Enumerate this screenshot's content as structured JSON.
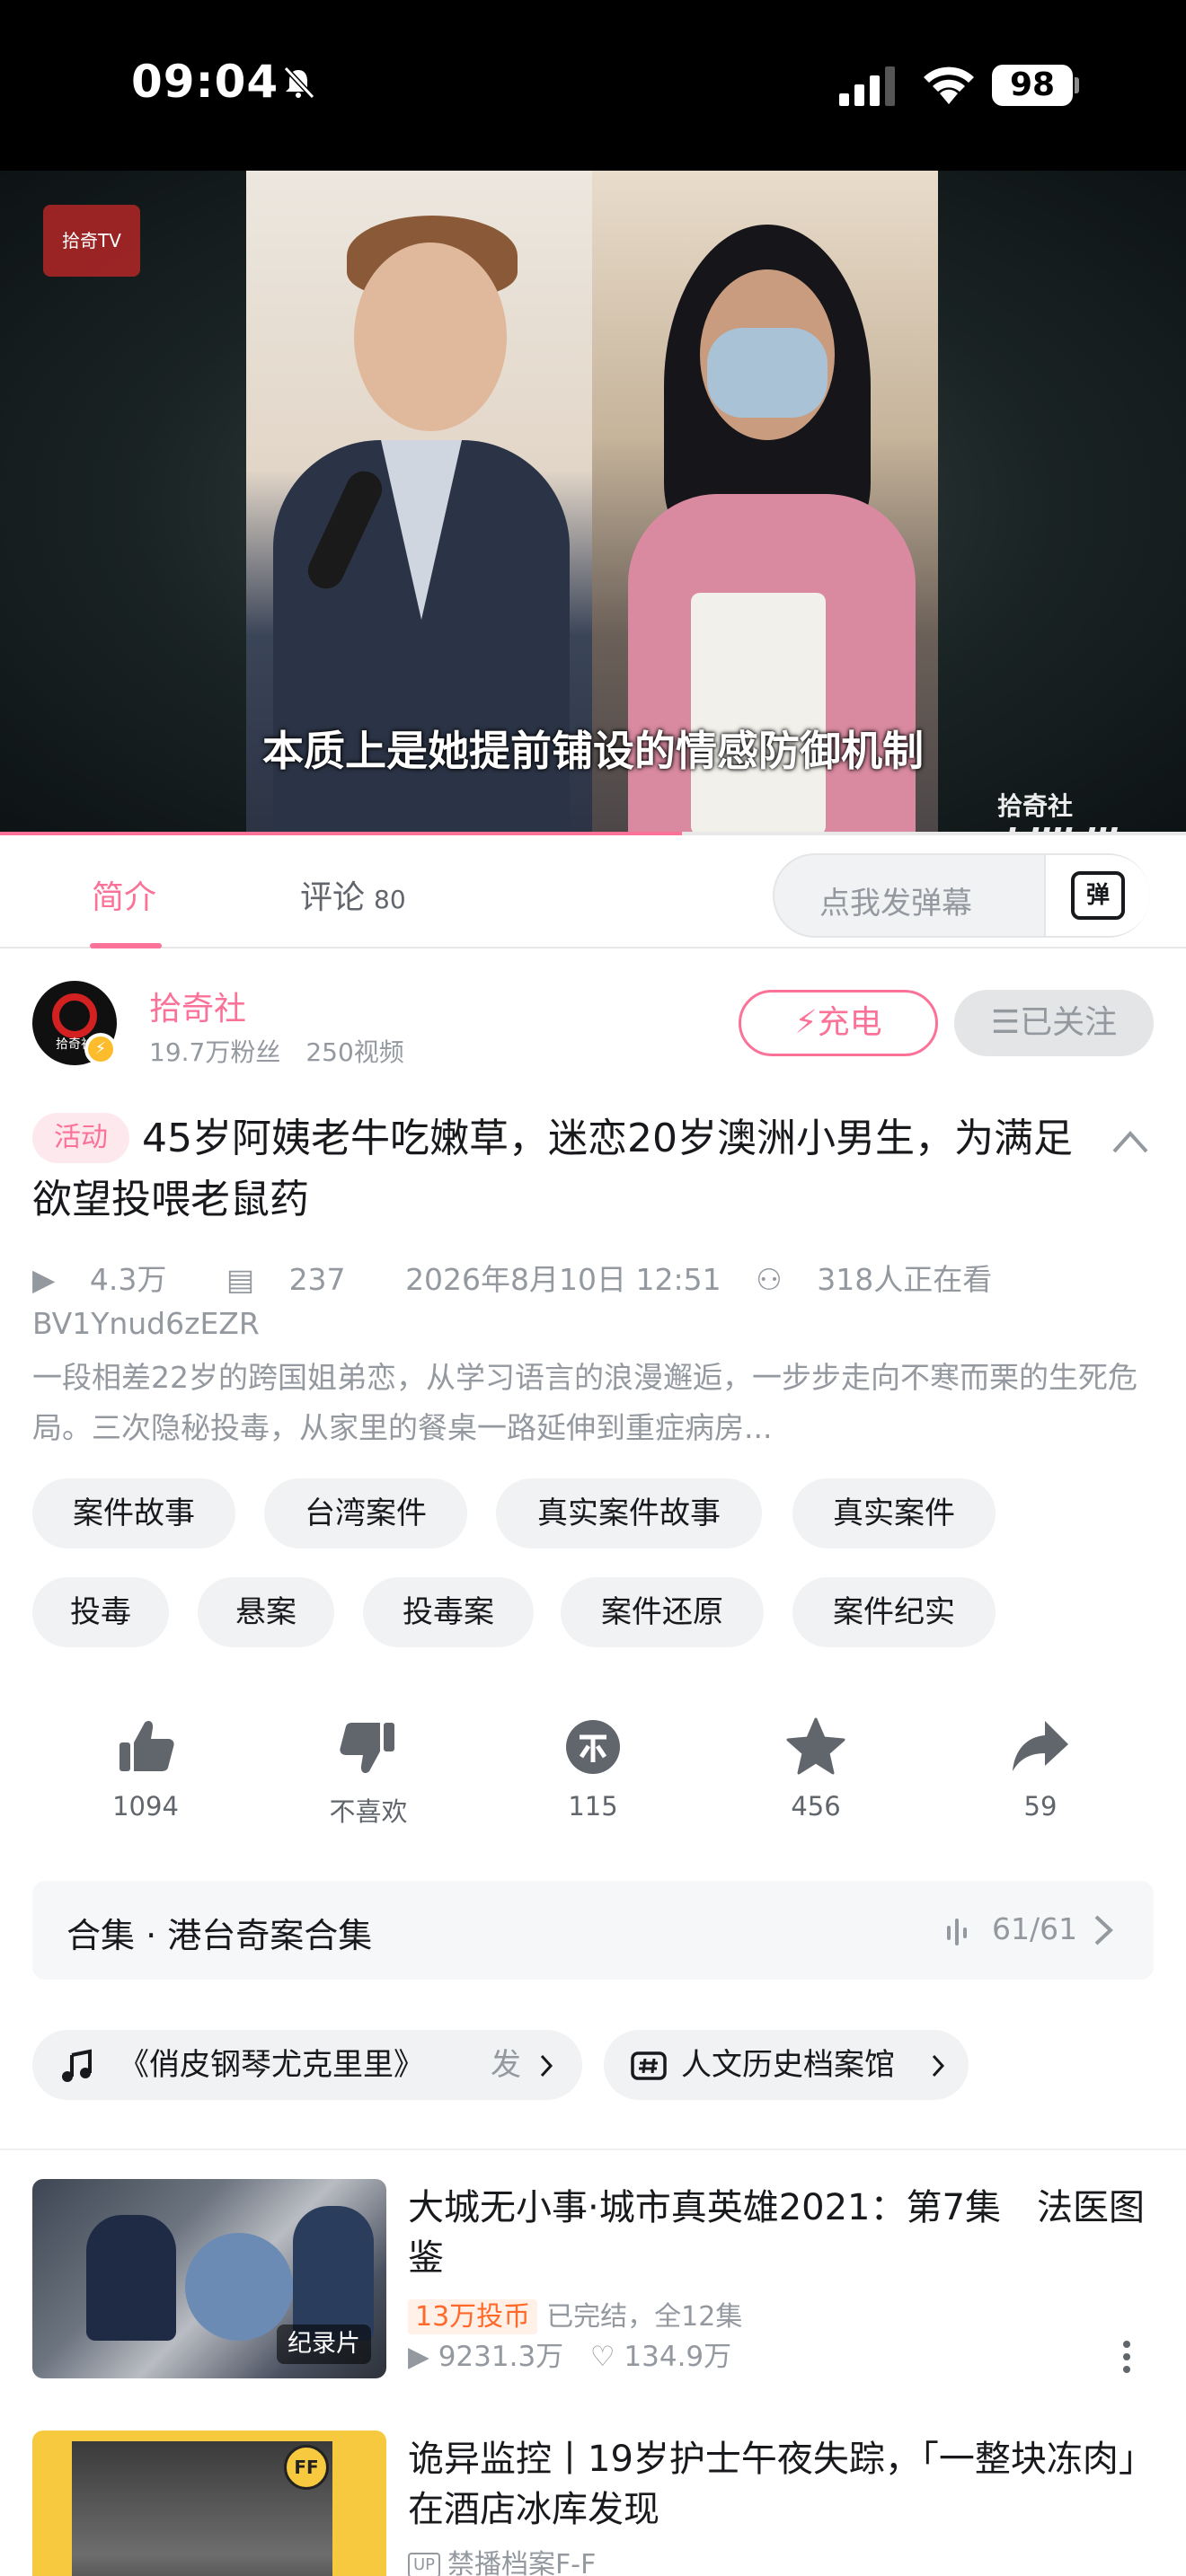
{
  "status": {
    "time": "09:04",
    "battery": "98"
  },
  "video": {
    "channel_logo": "拾奇TV",
    "subtitle": "本质上是她提前铺设的情感防御机制",
    "watermark_channel": "拾奇社",
    "watermark_brand": "bilibili",
    "progress_percent": 57.5
  },
  "tabs": {
    "intro": "简介",
    "comments": "评论",
    "comments_count": "80",
    "danmaku_placeholder": "点我发弹幕",
    "danmaku_button": "弹"
  },
  "uploader": {
    "avatar_text": "拾奇社",
    "name": "拾奇社",
    "stats": "19.7万粉丝　250视频",
    "charge_label": "充电",
    "follow_label": "已关注"
  },
  "video_info": {
    "badge": "活动",
    "title": "45岁阿姨老牛吃嫩草，迷恋20岁澳洲小男生，为满足欲望投喂老鼠药",
    "views": "4.3万",
    "danmaku": "237",
    "date": "2026年8月10日 12:51",
    "watching": "318人正在看",
    "bvid": "BV1Ynud6zEZR",
    "description": "一段相差22岁的跨国姐弟恋，从学习语言的浪漫邂逅，一步步走向不寒而栗的生死危局。三次隐秘投毒，从家里的餐桌一路延伸到重症病房..."
  },
  "tags": [
    "案件故事",
    "台湾案件",
    "真实案件故事",
    "真实案件",
    "投毒",
    "悬案",
    "投毒案",
    "案件还原",
    "案件纪实"
  ],
  "actions": {
    "like": "1094",
    "dislike": "不喜欢",
    "coin": "115",
    "favorite": "456",
    "share": "59"
  },
  "collection": {
    "title": "合集 · 港台奇案合集",
    "count": "61/61"
  },
  "chips": {
    "music": "《俏皮钢琴尤克里里》",
    "music_action": "发",
    "topic": "人文历史档案馆"
  },
  "recommendations": [
    {
      "title": "大城无小事·城市真英雄2021：第7集　法医图鉴",
      "thumb_tag": "纪录片",
      "coin_badge": "13万投币",
      "status": "已完结，全12集",
      "views": "9231.3万",
      "likes": "134.9万"
    },
    {
      "title": "诡异监控丨19岁护士午夜失踪，「一整块冻肉」在酒店冰库发现",
      "thumb_logo": "FF",
      "up_name": "禁播档案F-F"
    }
  ],
  "colors": {
    "accent": "#fb7299",
    "text_primary": "#18191c",
    "text_secondary": "#9499a0"
  }
}
